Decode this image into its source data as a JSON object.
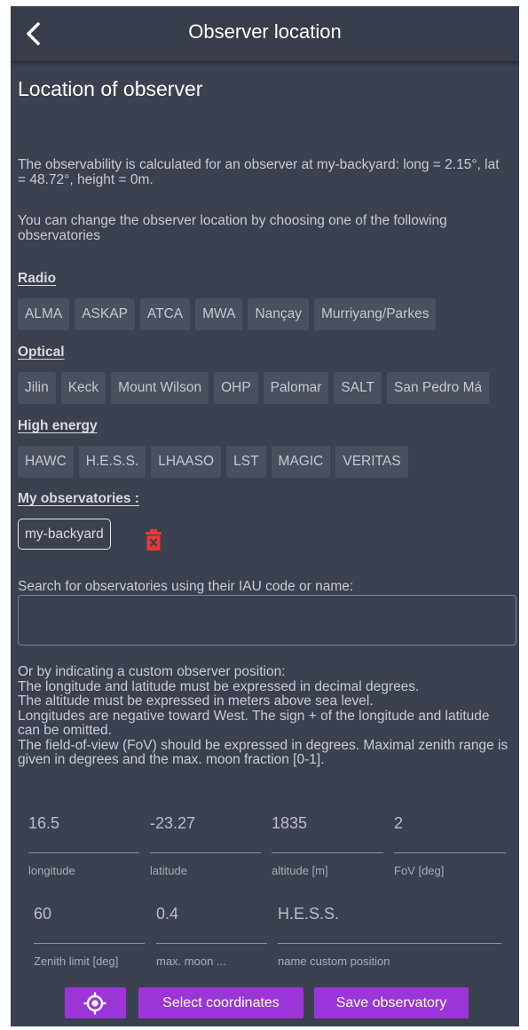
{
  "header": {
    "title": "Observer location"
  },
  "page_title": "Location of observer",
  "intro": "The observability is calculated for an observer at my-backyard: long = 2.15°, lat = 48.72°, height = 0m.",
  "change_text": "You can change the observer location by choosing one of the following observatories",
  "sections": {
    "radio": {
      "label": "Radio",
      "items": [
        "ALMA",
        "ASKAP",
        "ATCA",
        "MWA",
        "Nançay",
        "Murriyang/Parkes"
      ]
    },
    "optical": {
      "label": "Optical",
      "items": [
        "Jilin",
        "Keck",
        "Mount Wilson",
        "OHP",
        "Palomar",
        "SALT",
        "San Pedro Má"
      ]
    },
    "high_energy": {
      "label": "High energy",
      "items": [
        "HAWC",
        "H.E.S.S.",
        "LHAASO",
        "LST",
        "MAGIC",
        "VERITAS"
      ]
    },
    "mine": {
      "label": "My observatories :",
      "items": [
        "my-backyard"
      ]
    }
  },
  "search": {
    "label": "Search for observatories using their IAU code or name:",
    "placeholder": ""
  },
  "custom": {
    "lines": [
      "Or by indicating a custom observer position:",
      "The longitude and latitude must be expressed in decimal degrees.",
      "The altitude must be expressed in meters above sea level.",
      "Longitudes are negative toward West. The sign + of the longitude and latitude can be omitted.",
      "The field-of-view (FoV) should be expressed in degrees. Maximal zenith range is given in degrees and the max. moon fraction [0-1]."
    ]
  },
  "fields": {
    "longitude": {
      "value": "16.5",
      "label": "longitude"
    },
    "latitude": {
      "value": "-23.27",
      "label": "latitude"
    },
    "altitude": {
      "value": "1835",
      "label": "altitude [m]"
    },
    "fov": {
      "value": "2",
      "label": "FoV [deg]"
    },
    "zenith": {
      "value": "60",
      "label": "Zenith limit [deg]"
    },
    "moon": {
      "value": "0.4",
      "label": "max. moon ..."
    },
    "name": {
      "value": "H.E.S.S.",
      "label": "name custom position"
    }
  },
  "buttons": {
    "select": "Select coordinates",
    "save": "Save observatory"
  },
  "icons": {
    "back": "chevron-left-icon",
    "trash": "trash-icon",
    "locate": "crosshair-target-icon"
  },
  "colors": {
    "background": "#3c4150",
    "accent": "#9c35d8",
    "delete": "#e53935"
  }
}
